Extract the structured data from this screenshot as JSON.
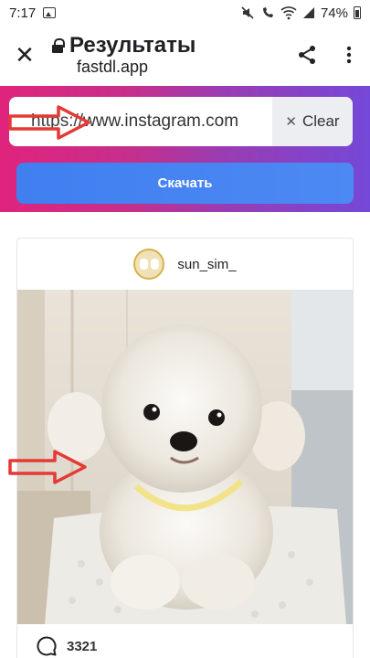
{
  "status_bar": {
    "time": "7:17",
    "battery": "74%"
  },
  "toolbar": {
    "title": "Результаты",
    "url": "fastdl.app"
  },
  "downloader": {
    "url_value": "https://www.instagram.com",
    "clear_label": "Clear",
    "download_label": "Скачать"
  },
  "post": {
    "username": "sun_sim_",
    "comment_count": "3321"
  },
  "colors": {
    "hero_start": "#e0247c",
    "hero_end": "#7448d8",
    "button_blue": "#4285f4",
    "annotation_red": "#e53935"
  },
  "icons": {
    "close": "close-icon",
    "lock": "lock-icon",
    "share": "share-icon",
    "menu": "more-vert-icon",
    "comment": "comment-icon"
  }
}
